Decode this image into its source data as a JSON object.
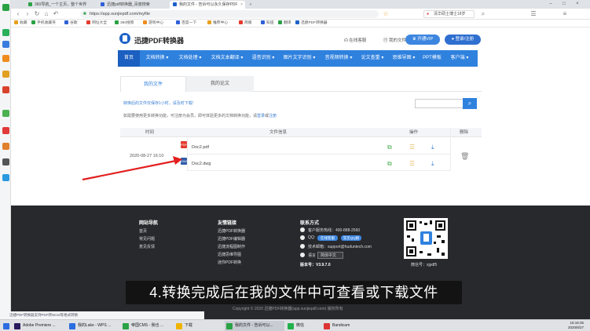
{
  "browser": {
    "tabs": [
      {
        "label": "360导航_一个主页，整个世界",
        "color": "#2ba245"
      },
      {
        "label": "迅捷pdf转换器_百度搜索",
        "color": "#3060d8"
      },
      {
        "label": "我的文件 - 告诉可以永久保存PDF",
        "color": "#1e62c8"
      }
    ],
    "url": "https://app.xunjiepdf.com/myfile",
    "search_value": "清华硕士博士18岁",
    "bookmarks": [
      "收藏",
      "手机收藏夹",
      "谷歌",
      "网址大全",
      "360搜索",
      "游戏中心",
      "",
      "",
      "百度一下",
      "",
      "推荐中心",
      "",
      "",
      "简版",
      "",
      "",
      "知道",
      "",
      "",
      "",
      "",
      "翻译",
      "",
      "",
      "",
      "",
      "",
      "",
      "",
      "",
      "",
      "迅捷PDF转换器"
    ],
    "status_text": "迅捷PDF转换器支持PDF转Word等格式转换"
  },
  "site": {
    "logo_text": "迅捷PDF转换器",
    "online_service": "在线客服",
    "my_files": "我的文件",
    "vip_button": "开通VIP",
    "login_button": "登录/注册"
  },
  "nav": [
    "首页",
    "文档转换 ▾",
    "文档处理 ▾",
    "文档文本翻译 ▾",
    "语音识别 ▾",
    "图片文字识别 ▾",
    "音视频转换 ▾",
    "论文查重 ▾",
    "思维导图 ▾",
    "PPT模板",
    "客户端 ▾"
  ],
  "content": {
    "tabs": [
      "我的文件",
      "我的论文"
    ],
    "info_line": "转换后的文件仅保存1小时，请及时下载!",
    "notice_prefix": "如需要使用更多转换功能，可注册为会员，即可体验更多的文档转换功能，请",
    "notice_login": "登录",
    "notice_or": "或",
    "notice_register": "注册",
    "table_headers": [
      "时间",
      "文件信息",
      "操作",
      "删除"
    ],
    "date": "2020-08-27 16:10",
    "files": [
      {
        "name": "Doc2.pdf",
        "type": "PDF",
        "color": "#e33b2e"
      },
      {
        "name": "Doc2.dwg",
        "type": "DWG",
        "color": "#2f5ca8"
      }
    ]
  },
  "footer": {
    "col1_title": "网站导航",
    "col1": [
      "首页",
      "常见问题",
      "意见反馈"
    ],
    "col2_title": "友情链接",
    "col2": [
      "迅捷PDF转换器",
      "迅捷PDF编辑器",
      "迅捷流程图制作",
      "迅捷思维导图",
      "迷你PDF转换"
    ],
    "contact_title": "联系方式",
    "hotline": "客户服务热线：400-888-2560",
    "qq_label": "QQ:",
    "qq_button1": "在线客服",
    "qq_button2": "常见QQ群",
    "email": "技术邮箱：support@huduntech.com",
    "lang_label": "语言",
    "lang_value": "简体中文",
    "version": "版本号：V3.9.7.0",
    "wechat": "微信号：xjpdf5",
    "copyright": "Copyright © 2020 迅捷PDF转换器(app.xunjiepdf.com) 版权所有"
  },
  "subtitle": "4.转换完成后在我的文件中可查看或下载文件",
  "taskbar": {
    "items": [
      {
        "label": "Adobe Premiere ...",
        "color": "#2a1a5e"
      },
      {
        "label": "我的Lake - WPS ...",
        "color": "#2b6de0"
      },
      {
        "label": "帝国CMS - 我也 ...",
        "color": "#2ba245"
      },
      {
        "label": "下载",
        "color": "#f0b400"
      },
      {
        "label": "我的文件 - 告诉可以...",
        "color": "#2ba245"
      },
      {
        "label": "微信",
        "color": "#22b14c"
      },
      {
        "label": "Bandicam",
        "color": "#d33"
      }
    ],
    "time": "16:16:35",
    "date": "2020/8/27"
  },
  "colors": {
    "accent": "#2f81de",
    "footer_bg": "#28292d"
  }
}
